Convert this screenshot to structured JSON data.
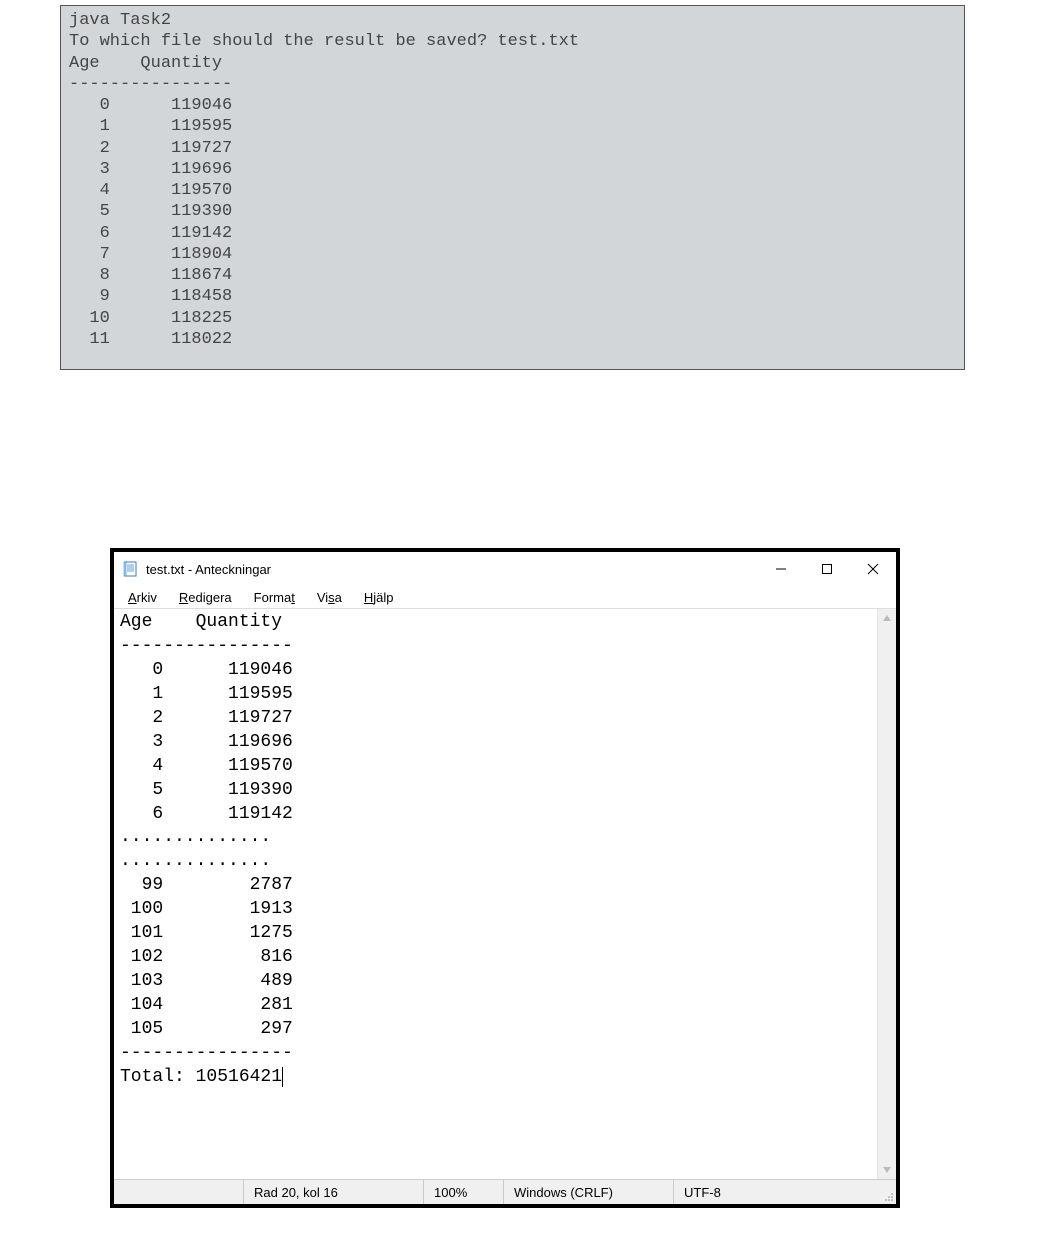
{
  "console": {
    "command": "java Task2",
    "prompt": "To which file should the result be saved? test.txt",
    "header_age": "Age",
    "header_qty": "Quantity",
    "divider": "----------------",
    "rows": [
      {
        "age": "0",
        "qty": "119046"
      },
      {
        "age": "1",
        "qty": "119595"
      },
      {
        "age": "2",
        "qty": "119727"
      },
      {
        "age": "3",
        "qty": "119696"
      },
      {
        "age": "4",
        "qty": "119570"
      },
      {
        "age": "5",
        "qty": "119390"
      },
      {
        "age": "6",
        "qty": "119142"
      },
      {
        "age": "7",
        "qty": "118904"
      },
      {
        "age": "8",
        "qty": "118674"
      },
      {
        "age": "9",
        "qty": "118458"
      },
      {
        "age": "10",
        "qty": "118225"
      },
      {
        "age": "11",
        "qty": "118022"
      }
    ]
  },
  "notepad": {
    "title": "test.txt - Anteckningar",
    "menu": {
      "arkiv": "Arkiv",
      "redigera": "Redigera",
      "format": "Format",
      "visa": "Visa",
      "hjalp": "Hjälp"
    },
    "body": {
      "header_age": "Age",
      "header_qty": "Quantity",
      "divider": "----------------",
      "rows_top": [
        {
          "age": "0",
          "qty": "119046"
        },
        {
          "age": "1",
          "qty": "119595"
        },
        {
          "age": "2",
          "qty": "119727"
        },
        {
          "age": "3",
          "qty": "119696"
        },
        {
          "age": "4",
          "qty": "119570"
        },
        {
          "age": "5",
          "qty": "119390"
        },
        {
          "age": "6",
          "qty": "119142"
        }
      ],
      "ellipsis": "..............",
      "rows_bottom": [
        {
          "age": "99",
          "qty": "2787"
        },
        {
          "age": "100",
          "qty": "1913"
        },
        {
          "age": "101",
          "qty": "1275"
        },
        {
          "age": "102",
          "qty": "816"
        },
        {
          "age": "103",
          "qty": "489"
        },
        {
          "age": "104",
          "qty": "281"
        },
        {
          "age": "105",
          "qty": "297"
        }
      ],
      "total_label": "Total:",
      "total_value": "10516421"
    },
    "status": {
      "pos": "Rad 20, kol 16",
      "zoom": "100%",
      "eol": "Windows (CRLF)",
      "encoding": "UTF-8"
    }
  }
}
